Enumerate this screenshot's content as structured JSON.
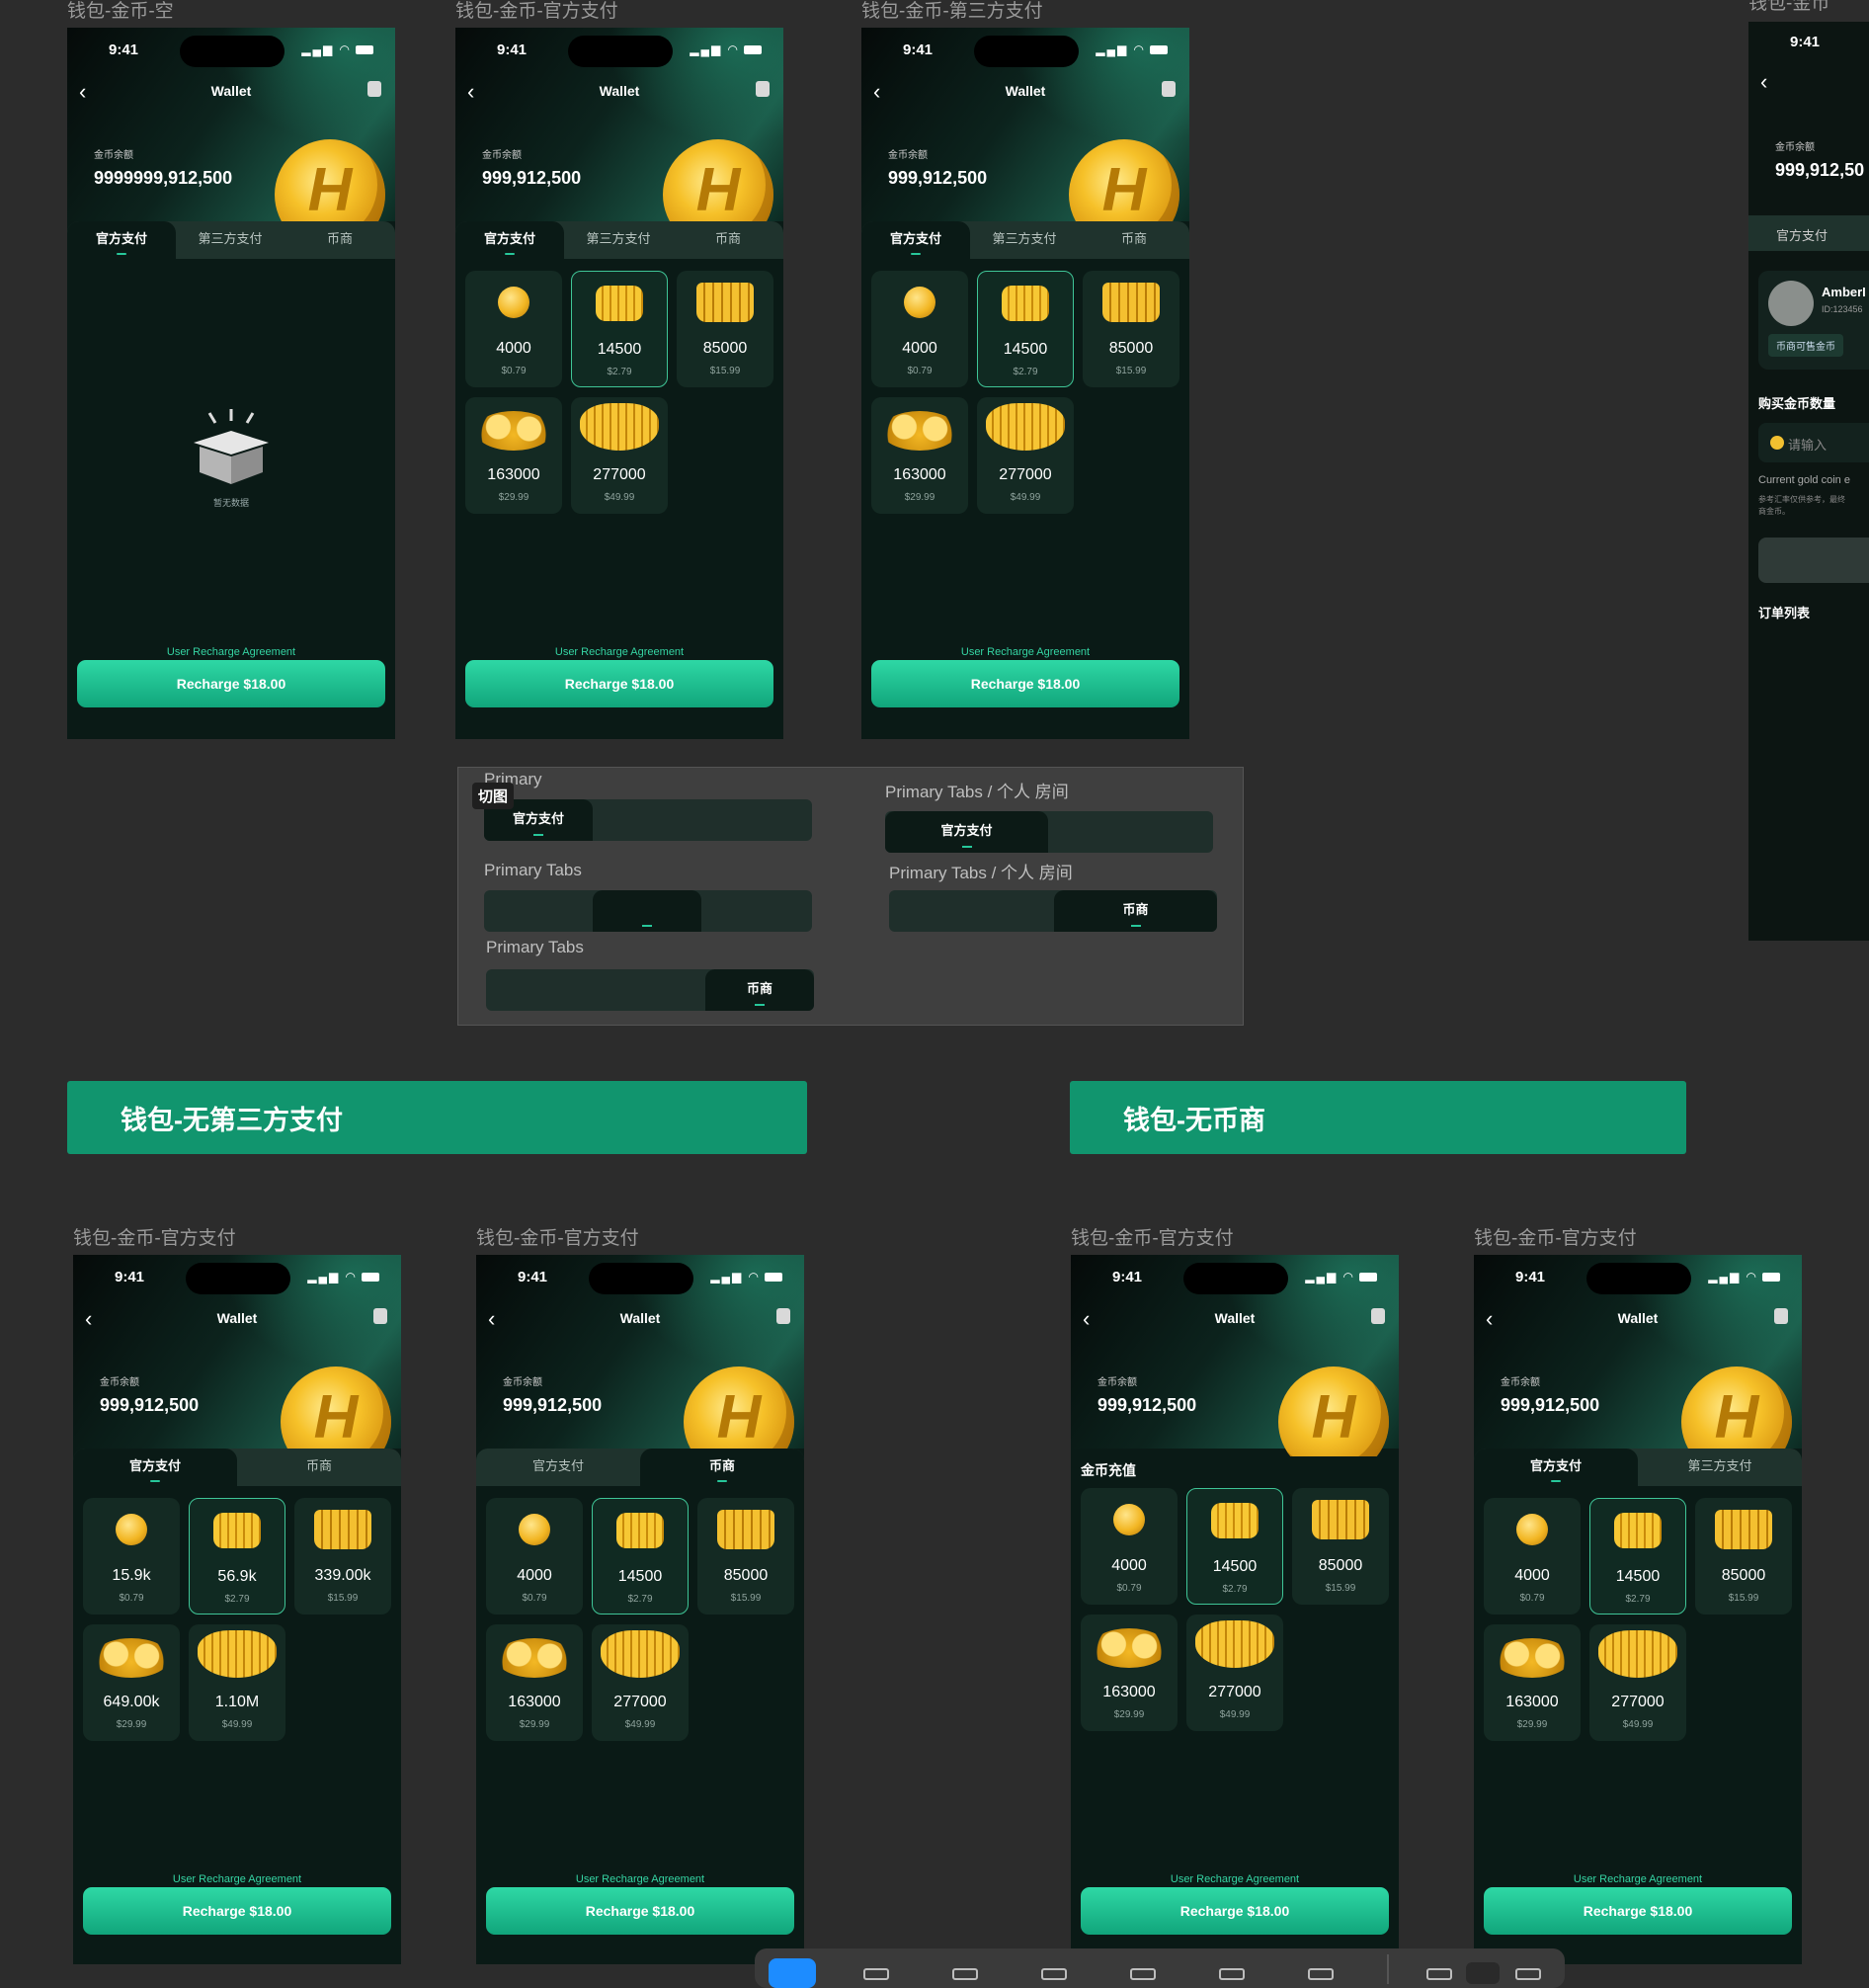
{
  "frame_labels": {
    "f1": "钱包-金币-空",
    "f2": "钱包-金币-官方支付",
    "f3": "钱包-金币-第三方支付",
    "f4": "钱包-金币",
    "f5": "钱包-金币-官方支付",
    "f6": "钱包-金币-官方支付",
    "f7": "钱包-金币-官方支付",
    "f8": "钱包-金币-官方支付"
  },
  "status": {
    "time": "9:41"
  },
  "header": {
    "title": "Wallet",
    "balance_label": "金币余额"
  },
  "balances": {
    "f1": "9999999,912,500",
    "std": "999,912,500",
    "cut": "999,912,50"
  },
  "tabs": {
    "official": "官方支付",
    "third": "第三方支付",
    "merchant": "币商"
  },
  "section_title": "金币充值",
  "empty_text": "暂无数据",
  "packs": [
    {
      "amount": "4000",
      "price": "$0.79"
    },
    {
      "amount": "14500",
      "price": "$2.79"
    },
    {
      "amount": "85000",
      "price": "$15.99"
    },
    {
      "amount": "163000",
      "price": "$29.99"
    },
    {
      "amount": "277000",
      "price": "$49.99"
    }
  ],
  "packs_short": [
    {
      "amount": "15.9k",
      "price": "$0.79"
    },
    {
      "amount": "56.9k",
      "price": "$2.79"
    },
    {
      "amount": "339.00k",
      "price": "$15.99"
    },
    {
      "amount": "649.00k",
      "price": "$29.99"
    },
    {
      "amount": "1.10M",
      "price": "$49.99"
    }
  ],
  "agreement": "User Recharge Agreement",
  "recharge_button": "Recharge $18.00",
  "slices": {
    "badge": "切图",
    "l1": "Primary",
    "l2": "Primary Tabs",
    "l3": "Primary Tabs",
    "r1": "Primary Tabs / 个人 房间",
    "r2": "Primary Tabs / 个人 房间"
  },
  "banners": {
    "left": "钱包-无第三方支付",
    "right": "钱包-无币商"
  },
  "right_panel": {
    "name": "AmberI",
    "id": "ID:123456",
    "tag": "币商可售金币",
    "buy_label": "购买金币数量",
    "input_placeholder": "请输入",
    "rate": "Current gold coin e",
    "note": "参考汇率仅供参考，最终",
    "note2": "商金币。",
    "orders": "订单列表"
  }
}
